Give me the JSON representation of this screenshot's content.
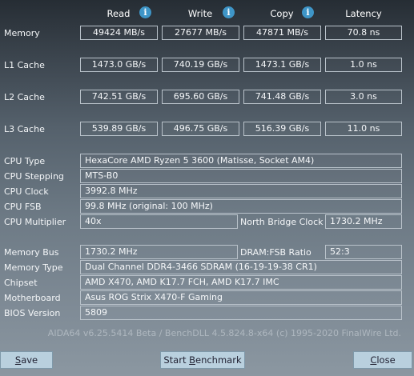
{
  "headers": {
    "read": "Read",
    "write": "Write",
    "copy": "Copy",
    "latency": "Latency"
  },
  "icons": {
    "info": "info-icon"
  },
  "benchmarks": {
    "memory": {
      "label": "Memory",
      "read": "49424 MB/s",
      "write": "27677 MB/s",
      "copy": "47871 MB/s",
      "latency": "70.8 ns"
    },
    "l1": {
      "label": "L1 Cache",
      "read": "1473.0 GB/s",
      "write": "740.19 GB/s",
      "copy": "1473.1 GB/s",
      "latency": "1.0 ns"
    },
    "l2": {
      "label": "L2 Cache",
      "read": "742.51 GB/s",
      "write": "695.60 GB/s",
      "copy": "741.48 GB/s",
      "latency": "3.0 ns"
    },
    "l3": {
      "label": "L3 Cache",
      "read": "539.89 GB/s",
      "write": "496.75 GB/s",
      "copy": "516.39 GB/s",
      "latency": "11.0 ns"
    }
  },
  "cpu": {
    "type_label": "CPU Type",
    "type_value": "HexaCore AMD Ryzen 5 3600  (Matisse, Socket AM4)",
    "stepping_label": "CPU Stepping",
    "stepping_value": "MTS-B0",
    "clock_label": "CPU Clock",
    "clock_value": "3992.8 MHz",
    "fsb_label": "CPU FSB",
    "fsb_value": "99.8 MHz  (original: 100 MHz)",
    "multiplier_label": "CPU Multiplier",
    "multiplier_value": "40x",
    "nb_clock_label": "North Bridge Clock",
    "nb_clock_value": "1730.2 MHz"
  },
  "memory_info": {
    "bus_label": "Memory Bus",
    "bus_value": "1730.2 MHz",
    "ratio_label": "DRAM:FSB Ratio",
    "ratio_value": "52:3",
    "type_label": "Memory Type",
    "type_value": "Dual Channel DDR4-3466 SDRAM  (16-19-19-38 CR1)",
    "chipset_label": "Chipset",
    "chipset_value": "AMD X470, AMD K17.7 FCH, AMD K17.7 IMC",
    "motherboard_label": "Motherboard",
    "motherboard_value": "Asus ROG Strix X470-F Gaming",
    "bios_label": "BIOS Version",
    "bios_value": "5809"
  },
  "copyright": "AIDA64 v6.25.5414 Beta / BenchDLL 4.5.824.8-x64  (c) 1995-2020 FinalWire Ltd.",
  "buttons": {
    "save": {
      "accel": "S",
      "rest": "ave"
    },
    "benchmark": {
      "pre": "Start ",
      "accel": "B",
      "rest": "enchmark"
    },
    "close": {
      "accel": "C",
      "rest": "lose"
    }
  }
}
